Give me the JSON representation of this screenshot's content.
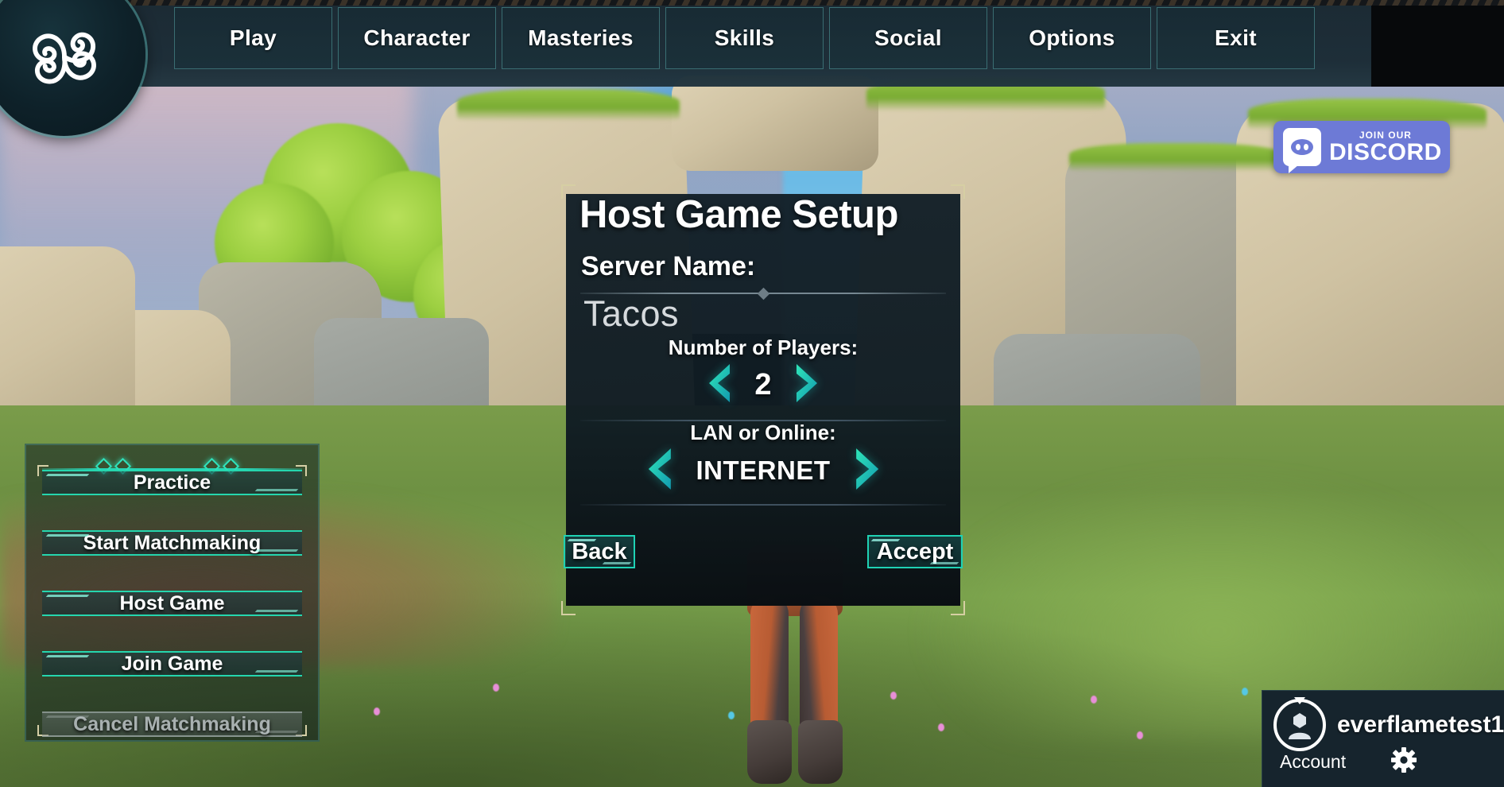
{
  "navbar": {
    "logo_icon": "triskelion-logo",
    "items": [
      {
        "label": "Play"
      },
      {
        "label": "Character"
      },
      {
        "label": "Masteries"
      },
      {
        "label": "Skills"
      },
      {
        "label": "Social"
      },
      {
        "label": "Options"
      },
      {
        "label": "Exit"
      }
    ]
  },
  "discord": {
    "join_label": "JOIN OUR",
    "word": "DISCORD",
    "bg_color": "#6d7ad6",
    "icon": "discord-icon"
  },
  "side_menu": {
    "items": [
      {
        "label": "Practice",
        "disabled": false
      },
      {
        "label": "Start Matchmaking",
        "disabled": false
      },
      {
        "label": "Host Game",
        "disabled": false
      },
      {
        "label": "Join Game",
        "disabled": false
      },
      {
        "label": "Cancel Matchmaking",
        "disabled": true
      }
    ]
  },
  "dialog": {
    "title": "Host Game Setup",
    "server_name_label": "Server Name:",
    "server_name_value": "Tacos",
    "players_label": "Number of Players:",
    "players_value": "2",
    "mode_label": "LAN or Online:",
    "mode_value": "INTERNET",
    "left_arrow_icon": "chevron-left-icon",
    "right_arrow_icon": "chevron-right-icon",
    "back_label": "Back",
    "accept_label": "Accept",
    "accent_color": "#1fd2b4",
    "corner_color": "#d6cfa3"
  },
  "account": {
    "username": "everflametest1",
    "account_label": "Account",
    "avatar_icon": "user-avatar-icon",
    "settings_icon": "gear-icon"
  }
}
